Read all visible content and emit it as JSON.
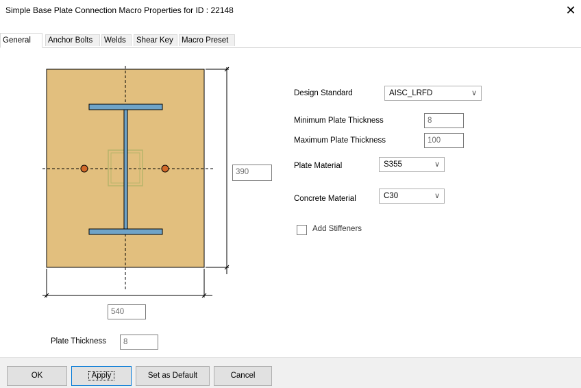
{
  "window": {
    "title": "Simple Base Plate Connection Macro Properties for ID : 22148",
    "close_glyph": "✕"
  },
  "tabs": [
    {
      "label": "General",
      "active": true
    },
    {
      "label": "Anchor Bolts",
      "active": false
    },
    {
      "label": "Welds",
      "active": false
    },
    {
      "label": "Shear Key",
      "active": false
    },
    {
      "label": "Macro Preset",
      "active": false
    }
  ],
  "diagram": {
    "height_value": "390",
    "width_value": "540",
    "plate_color": "#e2bf7e",
    "flange_color": "#6fa3c7",
    "bolt_color": "#d2692a",
    "stiffener_color": "#b8b46a"
  },
  "plate_thickness": {
    "label": "Plate Thickness",
    "value": "8"
  },
  "design_standard": {
    "label": "Design Standard",
    "value": "AISC_LRFD"
  },
  "min_plate_thickness": {
    "label": "Minimum Plate Thickness",
    "value": "8"
  },
  "max_plate_thickness": {
    "label": "Maximum Plate Thickness",
    "value": "100"
  },
  "plate_material": {
    "label": "Plate Material",
    "value": "S355"
  },
  "concrete_material": {
    "label": "Concrete Material",
    "value": "C30"
  },
  "add_stiffeners": {
    "label": "Add Stiffeners",
    "checked": false
  },
  "buttons": {
    "ok": "OK",
    "apply": "Apply",
    "set_default": "Set as Default",
    "cancel": "Cancel"
  },
  "icons": {
    "chevron": "chevron-down-icon",
    "close": "close-icon"
  }
}
